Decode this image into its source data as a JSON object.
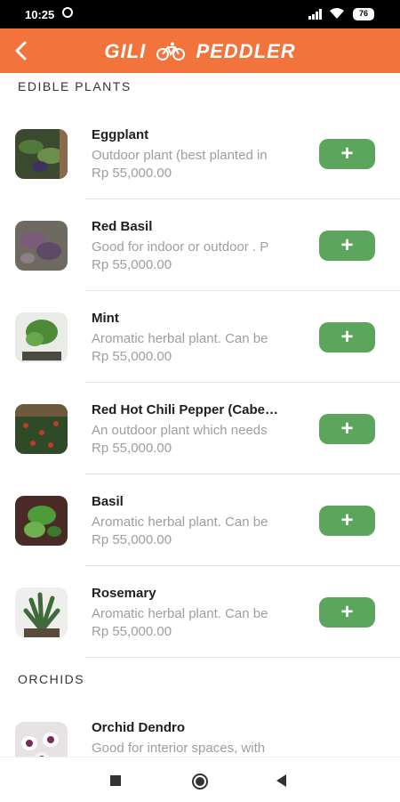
{
  "status_bar": {
    "time": "10:25",
    "battery": "76"
  },
  "app_bar": {
    "title_left": "GILI",
    "title_right": "PEDDLER",
    "back_icon": "arrow-left-icon",
    "brand_color": "#f2743c"
  },
  "sections": [
    {
      "title": "EDIBLE PLANTS",
      "items": [
        {
          "name": "Eggplant",
          "description": "Outdoor plant (best planted in",
          "price": "Rp 55,000.00",
          "add_label": "+"
        },
        {
          "name": "Red Basil",
          "description": "Good for indoor or outdoor . P",
          "price": "Rp 55,000.00",
          "add_label": "+"
        },
        {
          "name": "Mint",
          "description": "Aromatic herbal plant. Can be",
          "price": "Rp 55,000.00",
          "add_label": "+"
        },
        {
          "name": "Red Hot Chili Pepper (Cabe…",
          "description": "An outdoor plant which needs",
          "price": "Rp 55,000.00",
          "add_label": "+"
        },
        {
          "name": "Basil",
          "description": "Aromatic herbal plant. Can be",
          "price": "Rp 55,000.00",
          "add_label": "+"
        },
        {
          "name": "Rosemary",
          "description": "Aromatic herbal plant. Can be",
          "price": "Rp 55,000.00",
          "add_label": "+"
        }
      ]
    },
    {
      "title": "ORCHIDS",
      "items": [
        {
          "name": "Orchid Dendro",
          "description": "Good for interior spaces, with"
        }
      ]
    }
  ],
  "colors": {
    "add_button": "#5ba55c",
    "muted_text": "#9e9e9e"
  }
}
